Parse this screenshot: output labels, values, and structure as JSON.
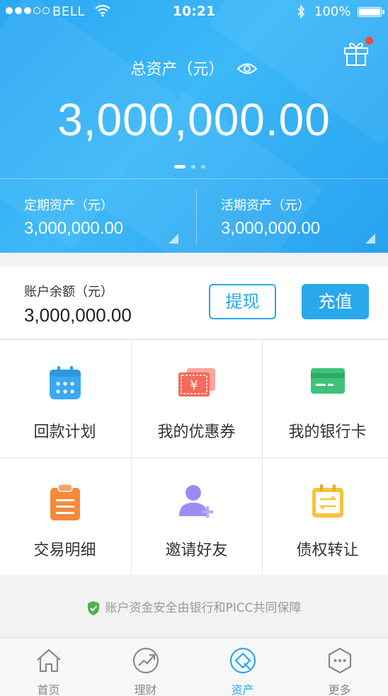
{
  "status_bar": {
    "carrier": "BELL",
    "time": "10:21",
    "battery": "100%"
  },
  "hero": {
    "total_label": "总资产（元）",
    "total_value": "3,000,000.00",
    "fixed_label": "定期资产（元）",
    "fixed_value": "3,000,000.00",
    "current_label": "活期资产（元）",
    "current_value": "3,000,000.00"
  },
  "balance": {
    "label": "账户余额（元）",
    "value": "3,000,000.00",
    "withdraw": "提现",
    "recharge": "充值"
  },
  "grid": [
    {
      "label": "回款计划",
      "icon": "calendar-icon",
      "color": "#3aa9f2"
    },
    {
      "label": "我的优惠券",
      "icon": "coupon-icon",
      "color": "#f56a5b"
    },
    {
      "label": "我的银行卡",
      "icon": "bank-card-icon",
      "color": "#3ec27a"
    },
    {
      "label": "交易明细",
      "icon": "clipboard-icon",
      "color": "#f7893a"
    },
    {
      "label": "邀请好友",
      "icon": "add-user-icon",
      "color": "#9a8df2"
    },
    {
      "label": "债权转让",
      "icon": "transfer-icon",
      "color": "#f5c43b"
    }
  ],
  "safety_note": "账户资金安全由银行和PICC共同保障",
  "tabs": [
    {
      "label": "首页",
      "icon": "home-icon"
    },
    {
      "label": "理财",
      "icon": "chart-trend-icon"
    },
    {
      "label": "资产",
      "icon": "assets-icon"
    },
    {
      "label": "更多",
      "icon": "more-icon"
    }
  ],
  "colors": {
    "accent": "#29a8ec",
    "safety_green": "#4cb04f"
  }
}
